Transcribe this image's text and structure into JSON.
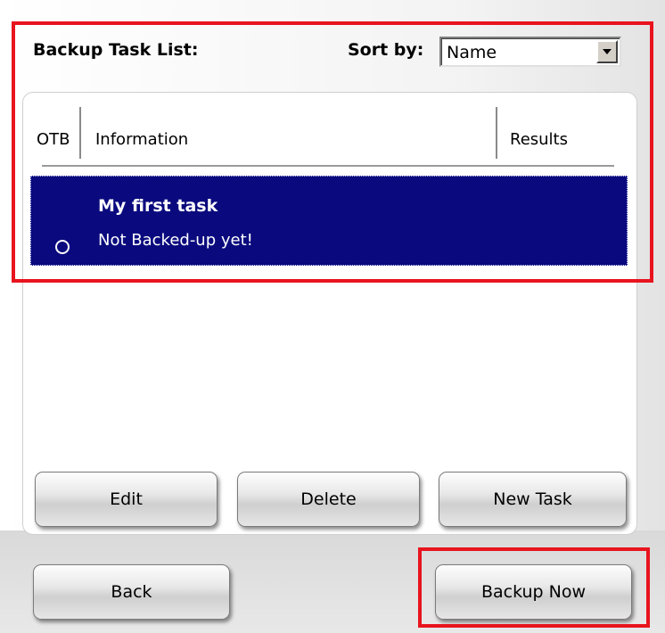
{
  "header": {
    "title": "Backup Task List:",
    "sort_label": "Sort by:",
    "sort_value": "Name",
    "sort_arrow_icon": "dropdown-arrow-icon"
  },
  "table": {
    "columns": [
      "OTB",
      "Information",
      "Results"
    ],
    "rows": [
      {
        "title": "My first task",
        "status": "Not Backed-up yet!",
        "otb_icon": "circle-icon",
        "selected": true
      }
    ]
  },
  "buttons": {
    "edit": "Edit",
    "delete": "Delete",
    "new_task": "New Task",
    "back": "Back",
    "backup_now": "Backup Now"
  },
  "colors": {
    "selection": "#0a0a7e",
    "highlight": "#e8141e"
  }
}
